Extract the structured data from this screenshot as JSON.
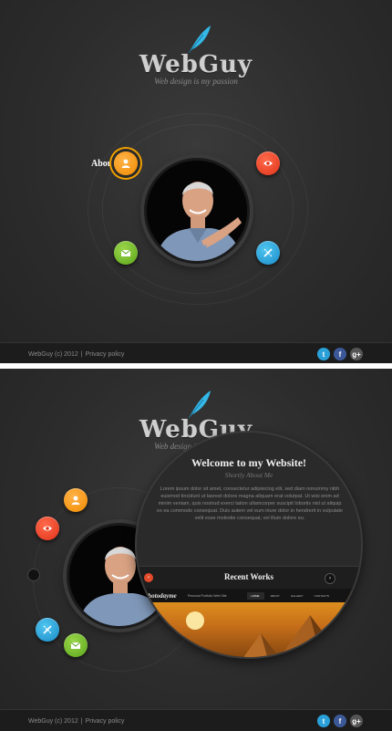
{
  "brand": {
    "name": "WebGuy",
    "tagline": "Web design is my passion"
  },
  "nav": {
    "about_label": "About"
  },
  "footer": {
    "copyright": "WebGuy (c) 2012",
    "separator": "|",
    "privacy": "Privacy policy"
  },
  "social": {
    "twitter": "t",
    "facebook": "f",
    "google_plus": "g+"
  },
  "welcome": {
    "title": "Welcome to my Website!",
    "subtitle": "Shortly About Me",
    "body": "Lorem ipsum dolor sit amet, consectetur adipisicing elit, sed diam nonummy nibh euismod tincidunt ut laoreet dolore magna aliquam erat volutpat. Ut wisi enim ad minim veniam, quis nostrud exerci tation ullamcorper suscipit lobortis nisl ut aliquip ex ea commodo consequat. Duis autem vel eum iriure dolor in hendrerit in vulputate velit esse molestie consequat, vel illum dolore eu."
  },
  "works": {
    "title": "Recent Works",
    "prev": "‹",
    "next": "›",
    "preview_brand": "Photodayme",
    "preview_tag": "Personal Portfolio Web Site",
    "preview_menu": [
      "HOME",
      "ABOUT",
      "GALLERY",
      "CONTACTS"
    ]
  },
  "colors": {
    "orange": "#f08a00",
    "red": "#e0321a",
    "green": "#5aa61a",
    "blue": "#1a8ac8",
    "background": "#2c2c2c"
  },
  "icons": {
    "about": "user-icon",
    "portfolio": "eye-icon",
    "contacts": "mail-icon",
    "services": "tools-icon",
    "logo": "feather-icon"
  }
}
